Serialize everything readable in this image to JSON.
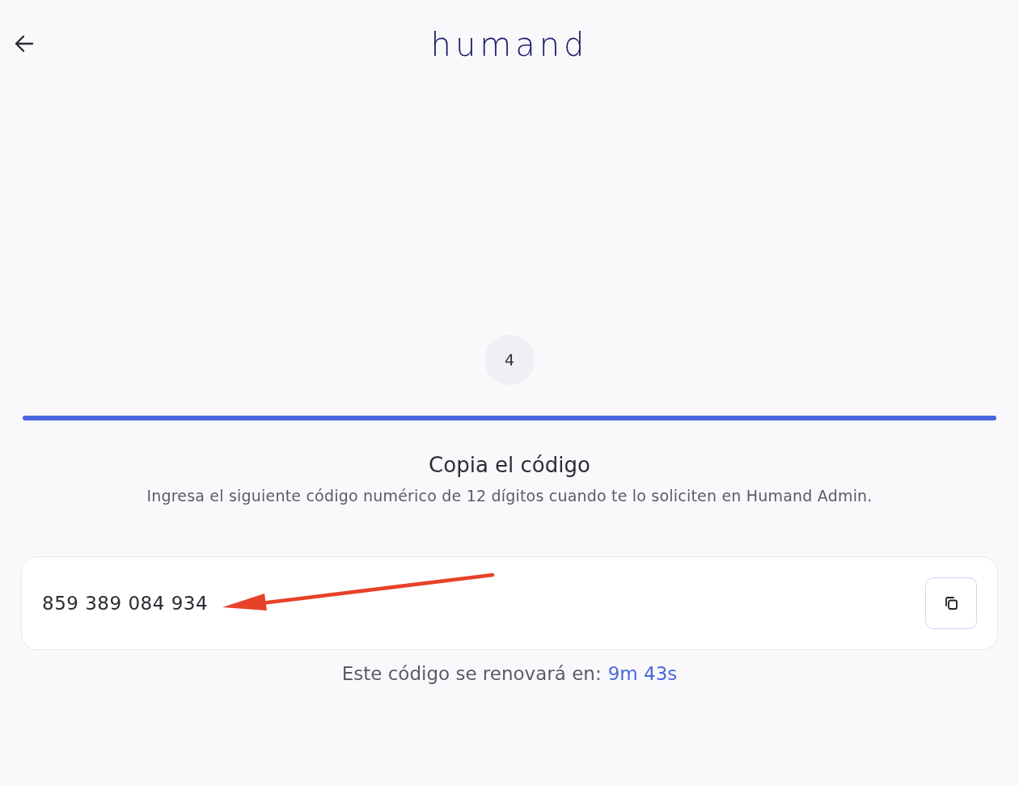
{
  "header": {
    "logo": "humand"
  },
  "step": {
    "number": "4",
    "level": 1
  },
  "title": "Copia el código",
  "description": "Ingresa el siguiente código numérico de 12 dígitos cuando te lo soliciten en Humand Admin.",
  "code": {
    "value": "859 389 084 934"
  },
  "timer": {
    "label": "Este código se renovará en:",
    "time": "9m 43s"
  }
}
